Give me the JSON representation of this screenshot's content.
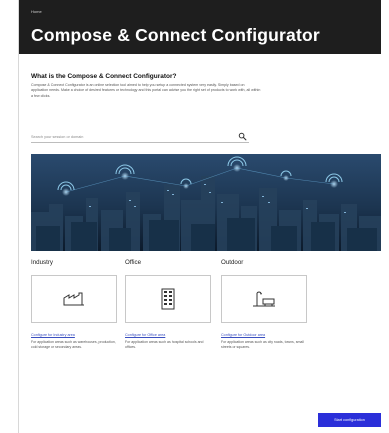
{
  "breadcrumb": "Home",
  "hero": {
    "title": "Compose & Connect Configurator"
  },
  "intro": {
    "heading": "What is the Compose & Connect Configurator?",
    "text": "Compose & Connect Configurator is an online selection tool aimed to help you setup a connected system very easily. Simply based on application needs. Make a choice of desired features or technology and this portal can advise you the right set of products to work with, all within a few clicks."
  },
  "search": {
    "placeholder": "Search your session or domain"
  },
  "categories": [
    {
      "title": "Industry",
      "icon": "factory-icon",
      "link": "Configure for Industry area",
      "description": "For application areas such as warehouses, production, cold storage or secondary areas."
    },
    {
      "title": "Office",
      "icon": "office-building-icon",
      "link": "Configure for Office area",
      "description": "For application areas such as hospital schools and offices."
    },
    {
      "title": "Outdoor",
      "icon": "street-lamp-icon",
      "link": "Configure for Outdoor area",
      "description": "For application areas such as city roads, towns, small streets or squares."
    }
  ],
  "cta": {
    "label": "Start configuration"
  },
  "colors": {
    "hero_bg": "#1e1e1e",
    "accent": "#2b2fd9",
    "link": "#3a4fc0",
    "city_glow": "#7fd0ff"
  }
}
